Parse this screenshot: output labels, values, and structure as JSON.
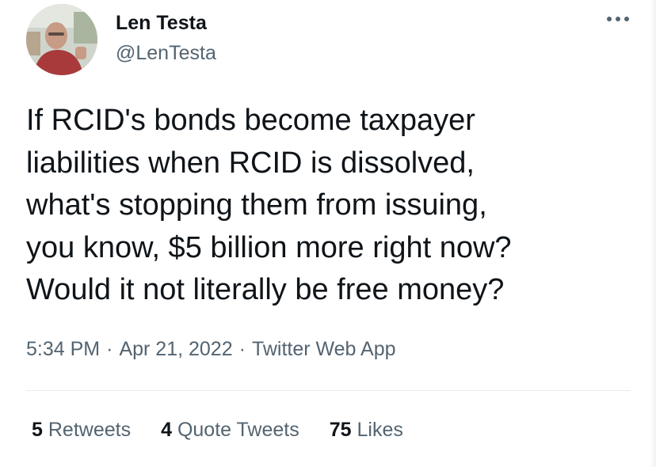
{
  "user": {
    "display_name": "Len Testa",
    "handle": "@LenTesta",
    "avatar_icon": "profile-photo"
  },
  "more_icon": "ellipsis-horizontal-icon",
  "tweet": {
    "lines": [
      "If RCID's bonds become taxpayer",
      "liabilities when RCID is dissolved,",
      "what's stopping them from issuing,",
      "you know, $5 billion more right now?",
      "Would it not literally be free money?"
    ]
  },
  "meta": {
    "time": "5:34 PM",
    "separator": "·",
    "date": "Apr 21, 2022",
    "app": "Twitter Web App"
  },
  "stats": {
    "retweets": {
      "count": "5",
      "label": "Retweets"
    },
    "quote_tweets": {
      "count": "4",
      "label": "Quote Tweets"
    },
    "likes": {
      "count": "75",
      "label": "Likes"
    }
  },
  "colors": {
    "text_primary": "#0f1419",
    "text_secondary": "#536471",
    "divider": "#e6ecf0"
  }
}
